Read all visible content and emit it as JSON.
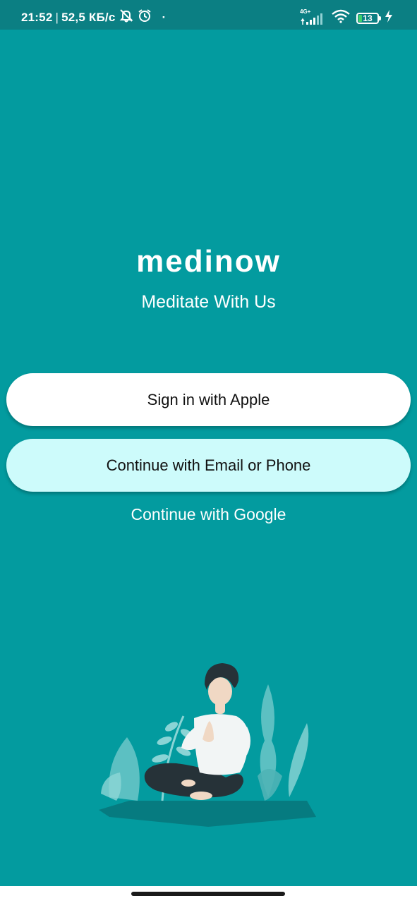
{
  "status_bar": {
    "time": "21:52",
    "separator": "|",
    "speed": "52,5 КБ/с",
    "dot": "·",
    "network_type": "4G+",
    "battery_level": "13",
    "icons": [
      "muted-bell-icon",
      "alarm-clock-icon",
      "signal-icon",
      "wifi-icon",
      "battery-icon",
      "charging-icon"
    ]
  },
  "app": {
    "logo": "medinow",
    "tagline": "Meditate With Us"
  },
  "actions": {
    "apple_label": "Sign in with Apple",
    "email_label": "Continue with Email or Phone",
    "google_label": "Continue with Google"
  },
  "colors": {
    "background": "#039b9f",
    "status_bar": "#0b7f83",
    "primary_button": "#ffffff",
    "secondary_button": "#cdfbfb",
    "text_on_background": "#ffffff"
  },
  "illustration": {
    "icon": "meditating-person-illustration"
  }
}
